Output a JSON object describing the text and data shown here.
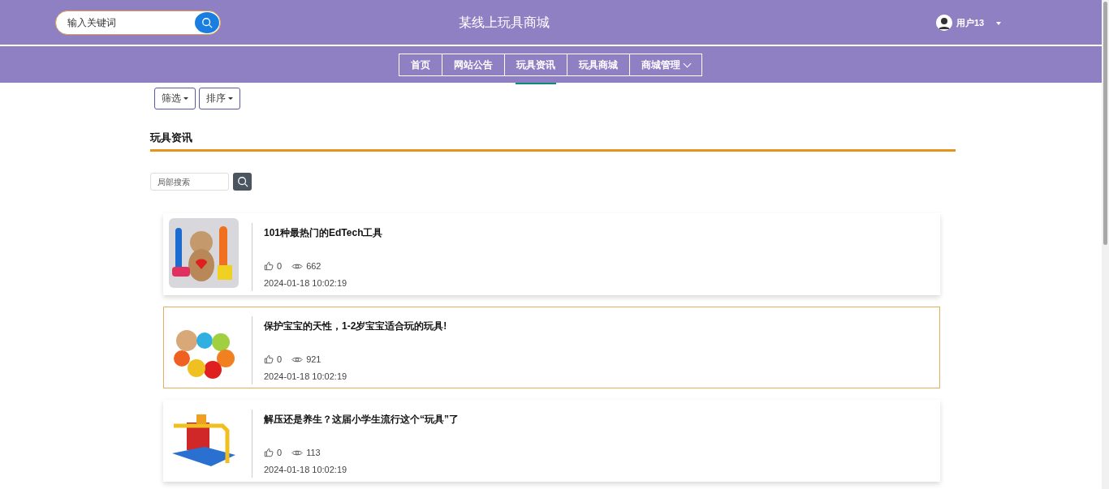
{
  "header": {
    "search": {
      "placeholder": "输入关键词"
    },
    "site_title": "某线上玩具商城",
    "user": {
      "name": "用户13"
    }
  },
  "nav": [
    {
      "label": "首页",
      "selected": false,
      "dropdown": false
    },
    {
      "label": "网站公告",
      "selected": false,
      "dropdown": false
    },
    {
      "label": "玩具资讯",
      "selected": true,
      "dropdown": false
    },
    {
      "label": "玩具商城",
      "selected": false,
      "dropdown": false
    },
    {
      "label": "商城管理",
      "selected": false,
      "dropdown": true
    }
  ],
  "filters": [
    "筛选",
    "排序"
  ],
  "section_title": "玩具资讯",
  "local_search": {
    "placeholder": "局部搜索"
  },
  "articles": [
    {
      "title": "101种最热门的EdTech工具",
      "likes": "0",
      "views": "662",
      "date": "2024-01-18 10:02:19",
      "selected": false
    },
    {
      "title": "保护宝宝的天性，1-2岁宝宝适合玩的玩具!",
      "likes": "0",
      "views": "921",
      "date": "2024-01-18 10:02:19",
      "selected": true
    },
    {
      "title": "解压还是养生？这届小学生流行这个“玩具”了",
      "likes": "0",
      "views": "113",
      "date": "2024-01-18 10:02:19",
      "selected": false
    }
  ]
}
